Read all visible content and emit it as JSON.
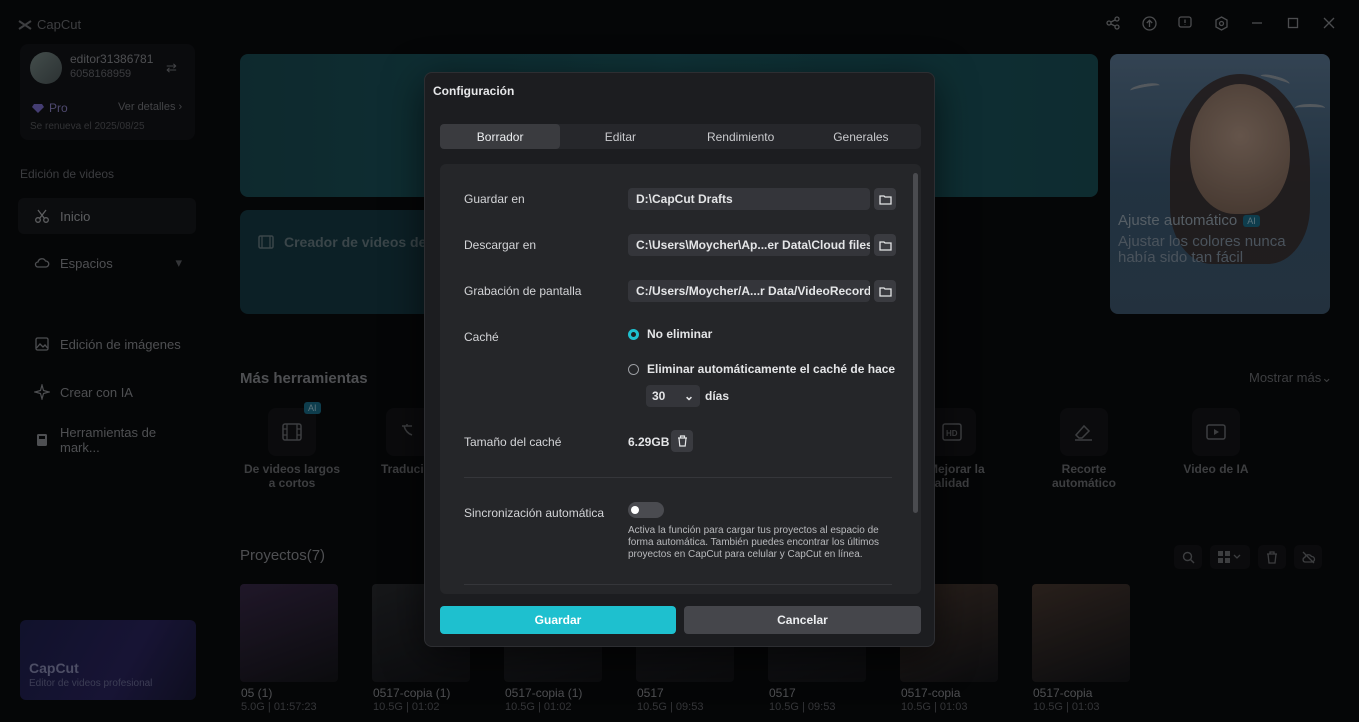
{
  "app": {
    "title": "CapCut"
  },
  "account": {
    "username": "editor31386781",
    "user_id": "6058168959",
    "plan": "Pro",
    "details_link": "Ver detalles",
    "renewal": "Se renueva el 2025/08/25"
  },
  "sidebar": {
    "section_title": "Edición de videos",
    "items": [
      {
        "label": "Inicio",
        "icon": "scissors-icon"
      },
      {
        "label": "Espacios",
        "icon": "cloud-icon"
      },
      {
        "label": "Edición de imágenes",
        "icon": "image-icon"
      },
      {
        "label": "Crear con IA",
        "icon": "sparkle-icon"
      },
      {
        "label": "Herramientas de mark...",
        "icon": "marketing-icon"
      }
    ],
    "promo": {
      "title": "CapCut",
      "subtitle": "Editor de videos profesional"
    }
  },
  "main": {
    "creator_card": "Creador de videos de",
    "feature": {
      "title": "Ajuste automático",
      "badge": "AI",
      "subtitle": "Ajustar los colores nunca había sido tan fácil"
    },
    "more_tools": {
      "title": "Más herramientas",
      "show_more": "Mostrar más",
      "tools": [
        {
          "label": "De videos largos a cortos",
          "badge": "AI",
          "icon": "film-icon"
        },
        {
          "label": "Traducir video",
          "icon": "translate-icon"
        },
        {
          "label": "Mejorar la calidad",
          "icon": "hd-icon"
        },
        {
          "label": "Recorte automático",
          "icon": "eraser-icon"
        },
        {
          "label": "Video de IA",
          "icon": "ai-video-icon"
        }
      ]
    },
    "projects": {
      "title": "Proyectos(7)",
      "items": [
        {
          "name": "05 (1)",
          "meta": "5.0G | 01:57:23",
          "tone": "#3a2a4a"
        },
        {
          "name": "0517-copia (1)",
          "meta": "10.5G | 01:02",
          "tone": "#2a2c30"
        },
        {
          "name": "0517-copia (1)",
          "meta": "10.5G | 01:02",
          "tone": "#2a2c30"
        },
        {
          "name": "0517",
          "meta": "10.5G | 09:53",
          "tone": "#25262a"
        },
        {
          "name": "0517",
          "meta": "10.5G | 09:53",
          "tone": "#25262a"
        },
        {
          "name": "0517-copia",
          "meta": "10.5G | 01:03",
          "tone": "#4a3a32"
        },
        {
          "name": "0517-copia",
          "meta": "10.5G | 01:03",
          "tone": "#4a3a32"
        }
      ]
    }
  },
  "modal": {
    "title": "Configuración",
    "tabs": [
      "Borrador",
      "Editar",
      "Rendimiento",
      "Generales"
    ],
    "active_tab": "Borrador",
    "save_in": {
      "label": "Guardar en",
      "value": "D:\\CapCut Drafts"
    },
    "download_in": {
      "label": "Descargar en",
      "value": "C:\\Users\\Moycher\\Ap...er Data\\Cloud files"
    },
    "screen_recording": {
      "label": "Grabación de pantalla",
      "value": "C:/Users/Moycher/A...r Data/VideoRecord"
    },
    "cache": {
      "label": "Caché",
      "option_keep": "No eliminar",
      "option_auto": "Eliminar automáticamente el caché de hace",
      "days_value": "30",
      "days_unit": "días"
    },
    "cache_size": {
      "label": "Tamaño del caché",
      "value": "6.29GB"
    },
    "auto_sync": {
      "label": "Sincronización automática",
      "description": "Activa la función para cargar tus proyectos al espacio de forma automática. También puedes encontrar los últimos proyectos en CapCut para celular y CapCut en línea."
    },
    "save_button": "Guardar",
    "cancel_button": "Cancelar"
  }
}
